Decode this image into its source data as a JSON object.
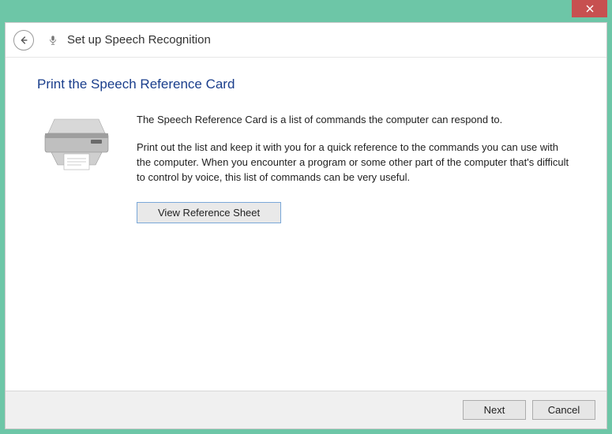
{
  "window": {
    "title": "Set up Speech Recognition"
  },
  "page": {
    "heading": "Print the Speech Reference Card",
    "para1": "The Speech Reference Card is a list of commands the computer can respond to.",
    "para2": "Print out the list and keep it with you for a quick reference to the commands you can use with the computer. When you encounter a program or some other part of the computer that's difficult to control by voice, this list of commands can be very useful.",
    "view_button": "View Reference Sheet"
  },
  "footer": {
    "next": "Next",
    "cancel": "Cancel"
  }
}
